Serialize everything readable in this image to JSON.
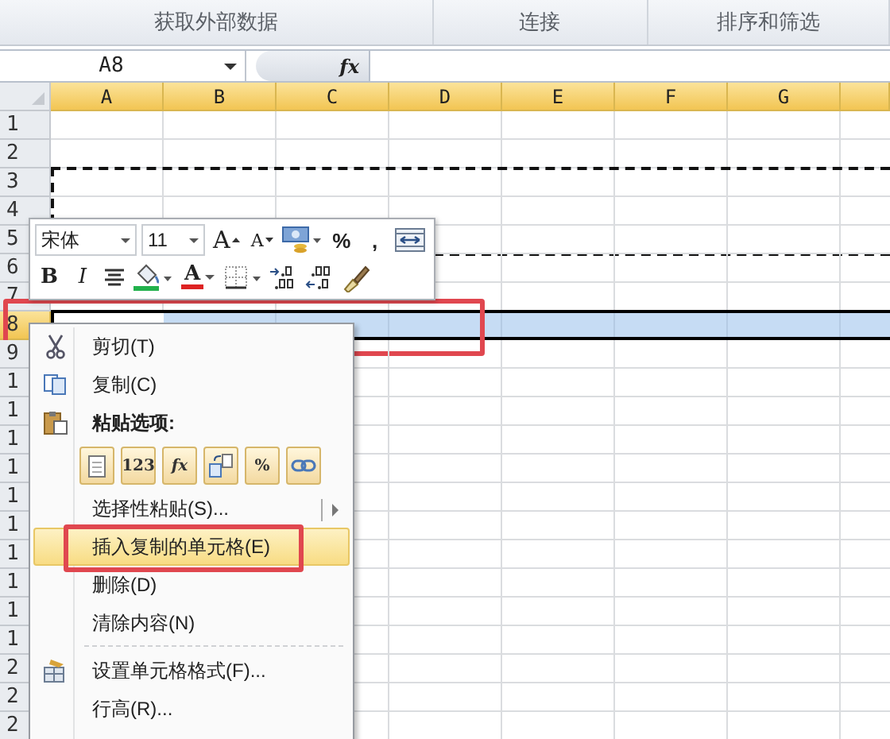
{
  "ribbon_groups": [
    "获取外部数据",
    "连接",
    "排序和筛选"
  ],
  "formula_bar": {
    "name_box": "A8",
    "fx": "fx"
  },
  "columns": [
    "A",
    "B",
    "C",
    "D",
    "E",
    "F",
    "G"
  ],
  "rows": [
    {
      "label": "1",
      "selected": false,
      "copied": false
    },
    {
      "label": "2",
      "selected": false,
      "copied": false
    },
    {
      "label": "3",
      "selected": false,
      "copied": true
    },
    {
      "label": "4",
      "selected": false,
      "copied": true
    },
    {
      "label": "5",
      "selected": false,
      "copied": true
    },
    {
      "label": "6",
      "selected": false,
      "copied": false
    },
    {
      "label": "7",
      "selected": false,
      "copied": false
    },
    {
      "label": "8",
      "selected": true,
      "copied": false,
      "annotated": true
    },
    {
      "label": "9",
      "selected": false,
      "copied": false
    },
    {
      "label": "1",
      "selected": false,
      "copied": false
    },
    {
      "label": "1",
      "selected": false,
      "copied": false
    },
    {
      "label": "1",
      "selected": false,
      "copied": false
    },
    {
      "label": "1",
      "selected": false,
      "copied": false
    },
    {
      "label": "1",
      "selected": false,
      "copied": false
    },
    {
      "label": "1",
      "selected": false,
      "copied": false
    },
    {
      "label": "1",
      "selected": false,
      "copied": false
    },
    {
      "label": "1",
      "selected": false,
      "copied": false
    },
    {
      "label": "1",
      "selected": false,
      "copied": false
    },
    {
      "label": "1",
      "selected": false,
      "copied": false
    },
    {
      "label": "2",
      "selected": false,
      "copied": false
    },
    {
      "label": "2",
      "selected": false,
      "copied": false
    },
    {
      "label": "2",
      "selected": false,
      "copied": false
    }
  ],
  "mini_toolbar": {
    "rows": [
      [
        {
          "kind": "combo",
          "value": "宋体"
        },
        {
          "kind": "combo",
          "value": "11"
        },
        {
          "kind": "grow",
          "text": "A"
        },
        {
          "kind": "shrink",
          "text": "A"
        },
        {
          "kind": "accounting"
        },
        {
          "kind": "glyph",
          "text": "%"
        },
        {
          "kind": "glyph",
          "text": ","
        },
        {
          "kind": "merge"
        }
      ],
      [
        {
          "kind": "bold",
          "text": "B"
        },
        {
          "kind": "italic",
          "text": "I"
        },
        {
          "kind": "center"
        },
        {
          "kind": "fill"
        },
        {
          "kind": "fontcolor",
          "text": "A"
        },
        {
          "kind": "borders"
        },
        {
          "kind": "incdec"
        },
        {
          "kind": "decdec"
        },
        {
          "kind": "painter"
        }
      ]
    ]
  },
  "context_menu": [
    {
      "kind": "cut",
      "label": "剪切(T)",
      "selected": false
    },
    {
      "kind": "copy",
      "label": "复制(C)",
      "selected": false
    },
    {
      "kind": "paste_header",
      "label": "粘贴选项:"
    },
    {
      "kind": "paste_options",
      "options": [
        {
          "kind": "paste"
        },
        {
          "kind": "values",
          "text": "123"
        },
        {
          "kind": "formulas",
          "text": "fx"
        },
        {
          "kind": "transpose"
        },
        {
          "kind": "formatting",
          "text": "%"
        },
        {
          "kind": "link"
        }
      ]
    },
    {
      "kind": "command",
      "label": "选择性粘贴(S)...",
      "submenu": true,
      "selected": false
    },
    {
      "kind": "command",
      "label": "插入复制的单元格(E)",
      "selected": true,
      "annotated": true
    },
    {
      "kind": "command",
      "label": "删除(D)",
      "selected": false
    },
    {
      "kind": "command",
      "label": "清除内容(N)",
      "selected": false
    },
    {
      "kind": "separator"
    },
    {
      "kind": "format",
      "label": "设置单元格格式(F)...",
      "selected": false
    },
    {
      "kind": "command",
      "label": "行高(R)...",
      "selected": false
    }
  ]
}
